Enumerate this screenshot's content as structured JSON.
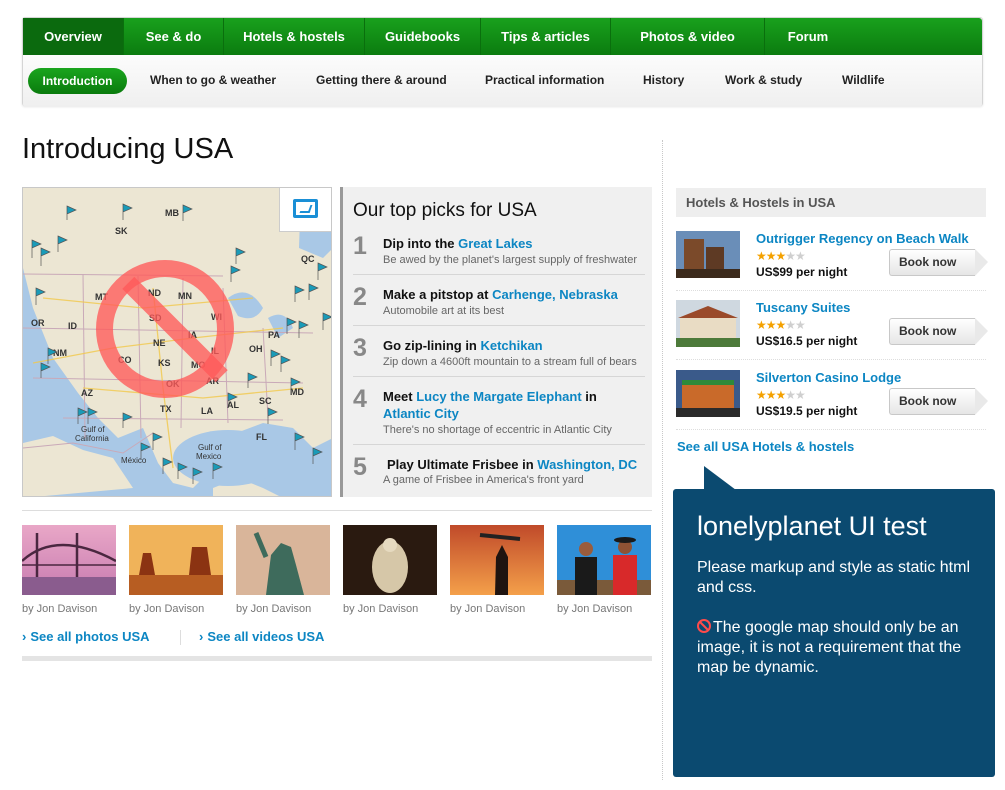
{
  "nav": {
    "primary_tabs": [
      "Overview",
      "See & do",
      "Hotels & hostels",
      "Guidebooks",
      "Tips & articles",
      "Photos & video",
      "Forum"
    ],
    "sub_tabs": [
      "Introduction",
      "When to go & weather",
      "Getting there & around",
      "Practical information",
      "History",
      "Work & study",
      "Wildlife"
    ]
  },
  "page": {
    "title": "Introducing USA"
  },
  "map": {
    "state_labels": [
      "SK",
      "MB",
      "QC",
      "MT",
      "ND",
      "MN",
      "WI",
      "OR",
      "ID",
      "SD",
      "IA",
      "IL",
      "OH",
      "CO",
      "KS",
      "MO",
      "NE",
      "OK",
      "AR",
      "AZ",
      "TX",
      "LA",
      "AL",
      "SC",
      "FL",
      "Gulf of California",
      "Gulf of Mexico",
      "México",
      "NM",
      "PA"
    ]
  },
  "picks": {
    "title": "Our top picks for USA",
    "items": [
      {
        "num": "1",
        "lead": "Dip into the ",
        "link": "Great Lakes",
        "tail": "",
        "sub": "Be awed by the planet's largest supply of freshwater"
      },
      {
        "num": "2",
        "lead": "Make a pitstop at ",
        "link": "Carhenge, Nebraska",
        "tail": "",
        "sub": "Automobile art at its best"
      },
      {
        "num": "3",
        "lead": "Go zip-lining in ",
        "link": "Ketchikan",
        "tail": "",
        "sub": "Zip down a 4600ft mountain to a stream full of bears"
      },
      {
        "num": "4",
        "lead": "Meet ",
        "link": "Lucy the Margate Elephant",
        "tail": " in",
        "link2": "Atlantic City",
        "sub": "There's no shortage of eccentric in Atlantic City"
      },
      {
        "num": "5",
        "lead": "Play Ultimate Frisbee in ",
        "link": "Washington, DC",
        "tail": "",
        "sub": "A game of Frisbee in America's front yard"
      }
    ]
  },
  "photos": {
    "credits": [
      "by Jon Davison",
      "by Jon Davison",
      "by Jon Davison",
      "by Jon Davison",
      "by Jon Davison",
      "by Jon Davison"
    ],
    "see_photos": "See all photos USA",
    "see_videos": "See all videos USA"
  },
  "hotels": {
    "heading": "Hotels & Hostels in USA",
    "items": [
      {
        "name": "Outrigger Regency on Beach Walk",
        "stars": 3,
        "price": "US$99 per night",
        "button": "Book now"
      },
      {
        "name": "Tuscany Suites",
        "stars": 3,
        "price": "US$16.5 per night",
        "button": "Book now"
      },
      {
        "name": "Silverton Casino Lodge",
        "stars": 3,
        "price": "US$19.5 per night",
        "button": "Book now"
      }
    ],
    "see_all": "See all USA Hotels & hostels"
  },
  "note": {
    "title": "lonelyplanet UI test",
    "p1": "Please markup and style as static html and css.",
    "p2": "The google map should only be an image, it is not a requirement that the map be dynamic."
  },
  "colors": {
    "nav_green": "#0b7c0f",
    "link_blue": "#0c86c3",
    "note_bg": "#0b4a70",
    "star": "#f4a100",
    "ban_red": "#ff5a5a"
  },
  "icons": [
    "expand-map-icon",
    "no-entry-icon",
    "chevron-right-icon",
    "star-icon",
    "map-flag-icon"
  ]
}
